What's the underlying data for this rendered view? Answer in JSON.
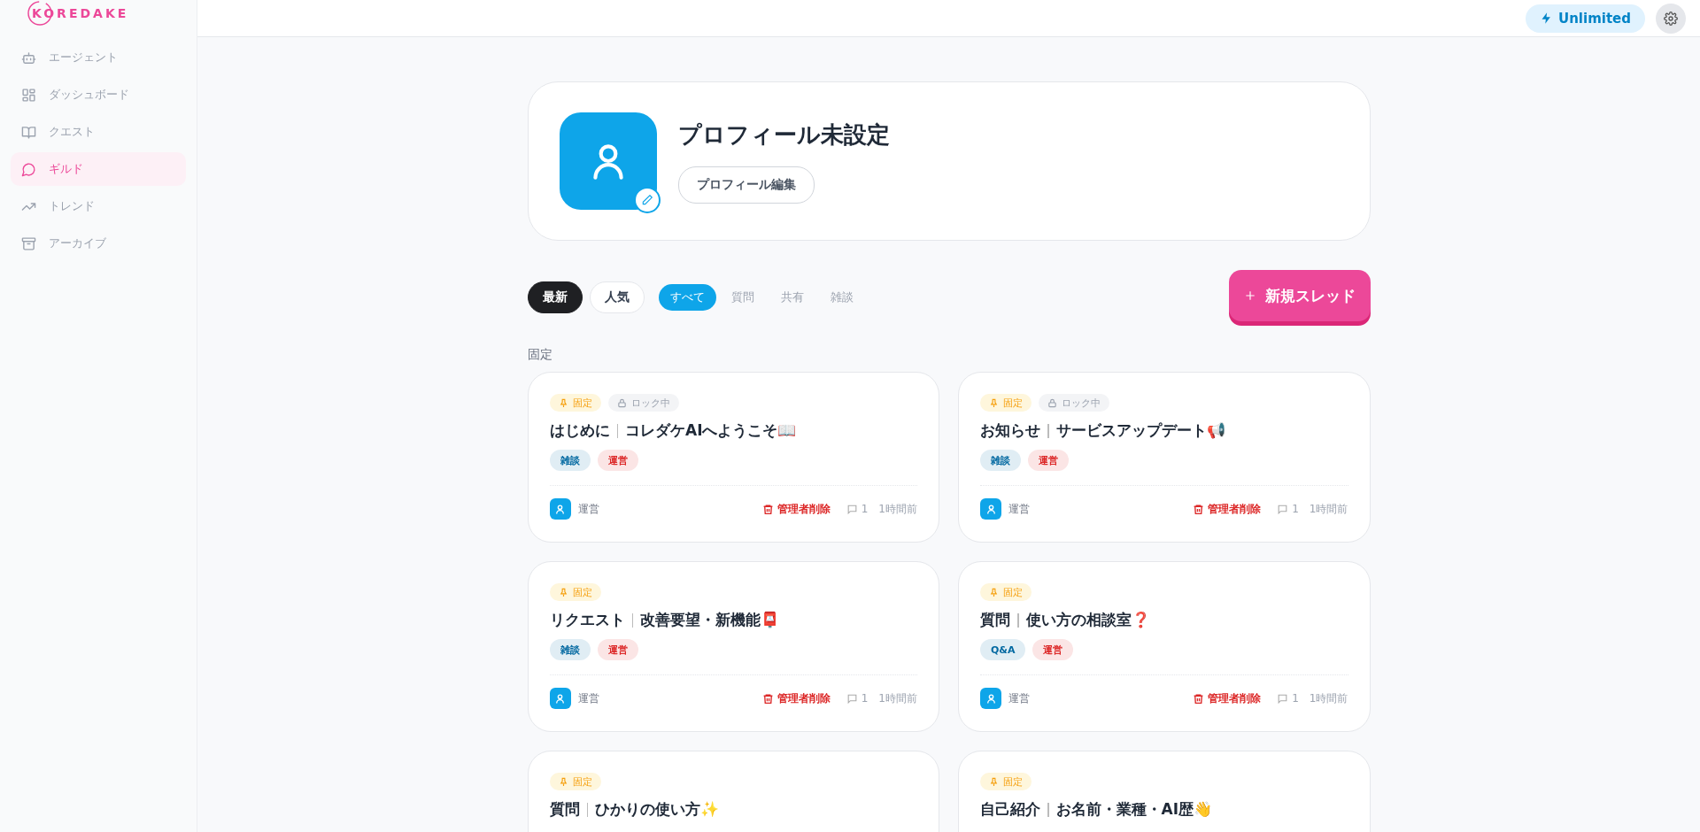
{
  "logo": {
    "text": "KOREDAKE"
  },
  "sidebar": {
    "items": [
      {
        "label": "エージェント",
        "selected": false
      },
      {
        "label": "ダッシュボード",
        "selected": false
      },
      {
        "label": "クエスト",
        "selected": false
      },
      {
        "label": "ギルド",
        "selected": true
      },
      {
        "label": "トレンド",
        "selected": false
      },
      {
        "label": "アーカイブ",
        "selected": false
      }
    ]
  },
  "header": {
    "plan_badge": "Unlimited"
  },
  "profile": {
    "name": "プロフィール未設定",
    "edit_button": "プロフィール編集"
  },
  "sort_tabs": [
    {
      "label": "最新",
      "selected": true
    },
    {
      "label": "人気",
      "selected": false
    }
  ],
  "category_tabs": [
    {
      "label": "すべて",
      "selected": true
    },
    {
      "label": "質問",
      "selected": false
    },
    {
      "label": "共有",
      "selected": false
    },
    {
      "label": "雑談",
      "selected": false
    }
  ],
  "new_thread_button": "新規スレッド",
  "section_label": "固定",
  "threads": [
    {
      "pinned": true,
      "pin_label": "固定",
      "locked": true,
      "lock_label": "ロック中",
      "category": "はじめに",
      "title": "コレダケAIへようこそ📖",
      "tags": [
        {
          "label": "雑談",
          "color": "#0369a1"
        },
        {
          "label": "運営",
          "color": "#dc2626"
        }
      ],
      "author": "運営",
      "delete_label": "管理者削除",
      "comments": "1",
      "time": "1時間前"
    },
    {
      "pinned": true,
      "pin_label": "固定",
      "locked": true,
      "lock_label": "ロック中",
      "category": "お知らせ",
      "title": "サービスアップデート📢",
      "tags": [
        {
          "label": "雑談",
          "color": "#0369a1"
        },
        {
          "label": "運営",
          "color": "#dc2626"
        }
      ],
      "author": "運営",
      "delete_label": "管理者削除",
      "comments": "1",
      "time": "1時間前"
    },
    {
      "pinned": true,
      "pin_label": "固定",
      "locked": false,
      "category": "リクエスト",
      "title": "改善要望・新機能📮",
      "tags": [
        {
          "label": "雑談",
          "color": "#0369a1"
        },
        {
          "label": "運営",
          "color": "#dc2626"
        }
      ],
      "author": "運営",
      "delete_label": "管理者削除",
      "comments": "1",
      "time": "1時間前"
    },
    {
      "pinned": true,
      "pin_label": "固定",
      "locked": false,
      "category": "質問",
      "title": "使い方の相談室❓",
      "tags": [
        {
          "label": "Q&A",
          "color": "#0369a1"
        },
        {
          "label": "運営",
          "color": "#dc2626"
        }
      ],
      "author": "運営",
      "delete_label": "管理者削除",
      "comments": "1",
      "time": "1時間前"
    },
    {
      "pinned": true,
      "pin_label": "固定",
      "locked": false,
      "category": "質問",
      "title": "ひかりの使い方✨"
    },
    {
      "pinned": true,
      "pin_label": "固定",
      "locked": false,
      "category": "自己紹介",
      "title": "お名前・業種・AI歴👋"
    }
  ]
}
